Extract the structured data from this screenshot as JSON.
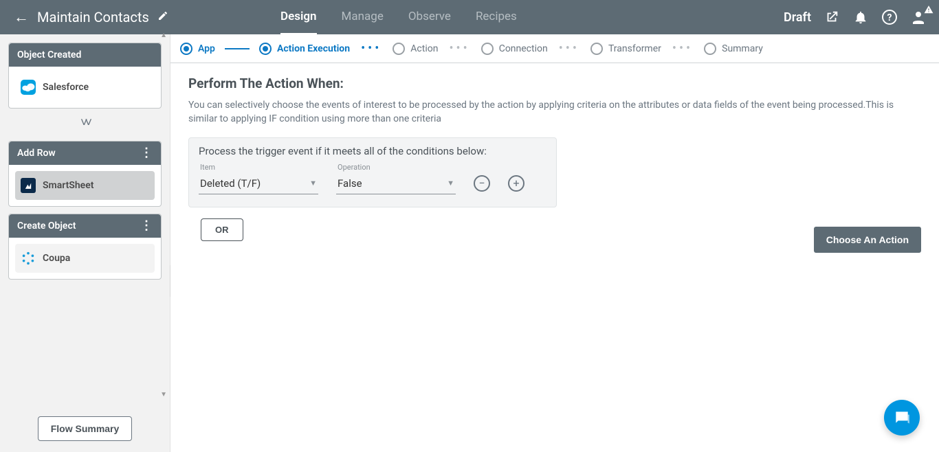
{
  "header": {
    "title": "Maintain Contacts",
    "tabs": [
      "Design",
      "Manage",
      "Observe",
      "Recipes"
    ],
    "active_tab": "Design",
    "status": "Draft"
  },
  "sidebar": {
    "blocks": [
      {
        "title": "Object Created",
        "app": "Salesforce",
        "menu": false,
        "style": "plain"
      },
      {
        "title": "Add Row",
        "app": "SmartSheet",
        "menu": true,
        "style": "selected"
      },
      {
        "title": "Create Object",
        "app": "Coupa",
        "menu": true,
        "style": "light"
      }
    ],
    "flow_summary": "Flow Summary"
  },
  "steps": {
    "items": [
      "App",
      "Action Execution",
      "Action",
      "Connection",
      "Transformer",
      "Summary"
    ],
    "done_index": 0,
    "current_index": 1
  },
  "panel": {
    "title": "Perform The Action When:",
    "description": "You can selectively choose the events of interest to be processed by the action by applying criteria on the attributes or data fields of the event being processed.This is similar to applying IF condition using more than one criteria",
    "condition_header": "Process the trigger event if it meets all of the conditions below:",
    "labels": {
      "item": "Item",
      "operation": "Operation"
    },
    "row": {
      "item": "Deleted (T/F)",
      "operation": "False"
    },
    "or_label": "OR",
    "choose_action": "Choose An Action"
  }
}
